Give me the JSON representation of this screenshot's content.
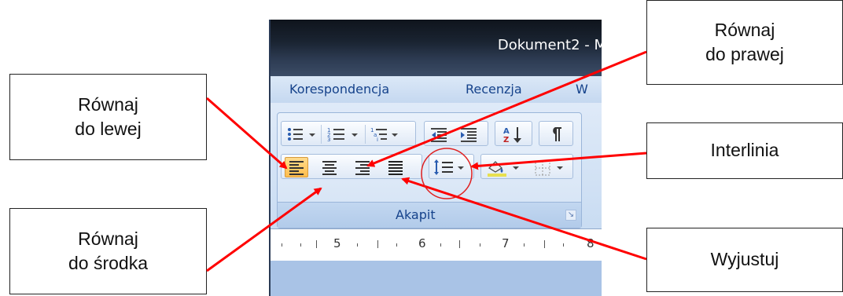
{
  "window": {
    "title": "Dokument2 - M"
  },
  "ribbon": {
    "tabs": [
      "Korespondencja",
      "Recenzja",
      "W"
    ],
    "group_label": "Akapit",
    "buttons": {
      "bullets": "bullets-icon",
      "numbering": "numbering-icon",
      "multilevel": "multilevel-list-icon",
      "decrease_indent": "decrease-indent-icon",
      "increase_indent": "increase-indent-icon",
      "sort": "sort-icon",
      "show_marks": "pilcrow-icon",
      "align_left": "align-left-icon",
      "align_center": "align-center-icon",
      "align_right": "align-right-icon",
      "justify": "justify-icon",
      "line_spacing": "line-spacing-icon",
      "shading": "shading-icon",
      "borders": "borders-icon"
    }
  },
  "ruler": {
    "numbers": [
      "5",
      "6",
      "7",
      "8"
    ]
  },
  "callouts": {
    "left": {
      "line1": "Równaj",
      "line2": "do lewej"
    },
    "center": {
      "line1": "Równaj",
      "line2": "do środka"
    },
    "right": {
      "line1": "Równaj",
      "line2": "do prawej"
    },
    "interlinia": "Interlinia",
    "wyjustuj": "Wyjustuj"
  },
  "colors": {
    "accent": "#ff0000",
    "tab_text": "#15428b",
    "active_button": "#ffc55a"
  }
}
